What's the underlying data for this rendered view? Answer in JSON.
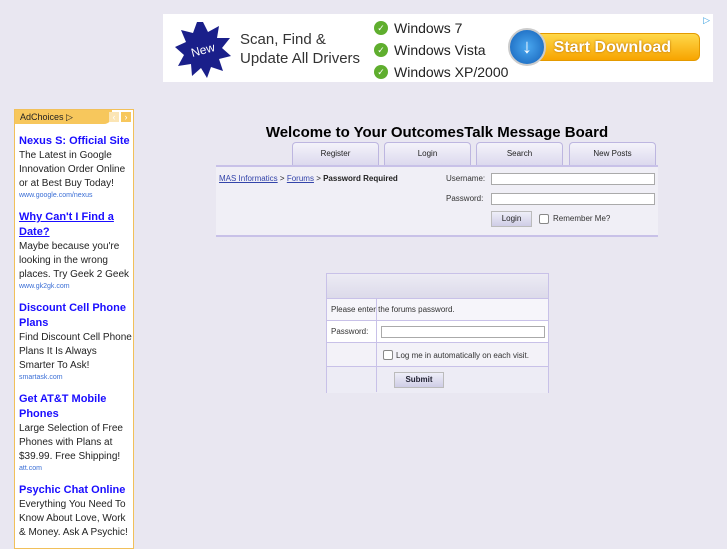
{
  "banner": {
    "badge": "New",
    "line1": "Scan, Find &",
    "line2": "Update All Drivers",
    "os": [
      "Windows 7",
      "Windows Vista",
      "Windows XP/2000"
    ],
    "cta": "Start Download"
  },
  "adchoices": "AdChoices",
  "ads": [
    {
      "title": "Nexus S: Official Site",
      "desc": "The Latest in Google Innovation Order Online or at Best Buy Today!",
      "url": "www.google.com/nexus"
    },
    {
      "title": "Why Can't I Find a Date?",
      "desc": "Maybe because you're looking in the wrong places. Try Geek 2 Geek",
      "url": "www.gk2gk.com"
    },
    {
      "title": "Discount Cell Phone Plans",
      "desc": "Find Discount Cell Phone Plans It Is Always Smarter To Ask!",
      "url": "smartask.com"
    },
    {
      "title": "Get AT&T Mobile Phones",
      "desc": "Large Selection of Free Phones with Plans at $39.99. Free Shipping!",
      "url": "att.com"
    },
    {
      "title": "Psychic Chat Online",
      "desc": "Everything You Need To Know About Love, Work & Money. Ask A Psychic!",
      "url": ""
    }
  ],
  "title": "Welcome to Your OutcomesTalk Message Board",
  "tabs": [
    "Register",
    "Login",
    "Search",
    "New Posts"
  ],
  "breadcrumb": {
    "home": "MAS Informatics",
    "forums": "Forums",
    "sep": ">",
    "current": "Password Required"
  },
  "login": {
    "username_label": "Username:",
    "password_label": "Password:",
    "button": "Login",
    "remember": "Remember Me?"
  },
  "forum_password": {
    "prompt": "Please enter the forums password.",
    "password_label": "Password:",
    "auto_login": "Log me in automatically on each visit.",
    "submit": "Submit"
  }
}
